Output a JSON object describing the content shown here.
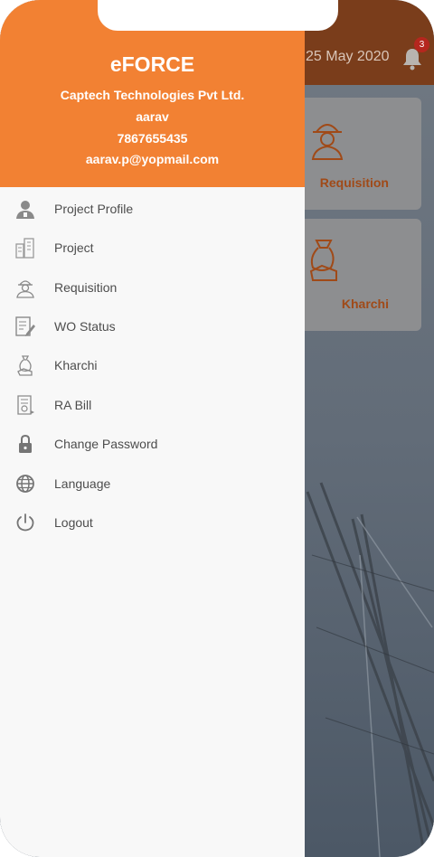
{
  "background": {
    "date_text": "25 May 2020",
    "notification_count": "3",
    "cards": [
      {
        "label": "Requisition",
        "icon": "worker-icon"
      },
      {
        "label": "Kharchi",
        "icon": "money-hand-icon"
      }
    ]
  },
  "drawer": {
    "brand": "eFORCE",
    "company": "Captech Technologies Pvt Ltd.",
    "user_name": "aarav",
    "phone": "7867655435",
    "email": "aarav.p@yopmail.com",
    "items": [
      {
        "label": "Project Profile",
        "icon": "user-profile-icon"
      },
      {
        "label": "Project",
        "icon": "buildings-icon"
      },
      {
        "label": "Requisition",
        "icon": "worker-icon"
      },
      {
        "label": "WO Status",
        "icon": "document-edit-icon"
      },
      {
        "label": "Kharchi",
        "icon": "money-bag-hand-icon"
      },
      {
        "label": "RA Bill",
        "icon": "bill-icon"
      },
      {
        "label": "Change Password",
        "icon": "lock-icon"
      },
      {
        "label": "Language",
        "icon": "globe-icon"
      },
      {
        "label": "Logout",
        "icon": "power-icon"
      }
    ]
  },
  "colors": {
    "drawer_header": "#f28133",
    "app_header": "#7a3d1b",
    "icon_gray": "#8a8a8a",
    "label_text": "#4d4d4d"
  }
}
